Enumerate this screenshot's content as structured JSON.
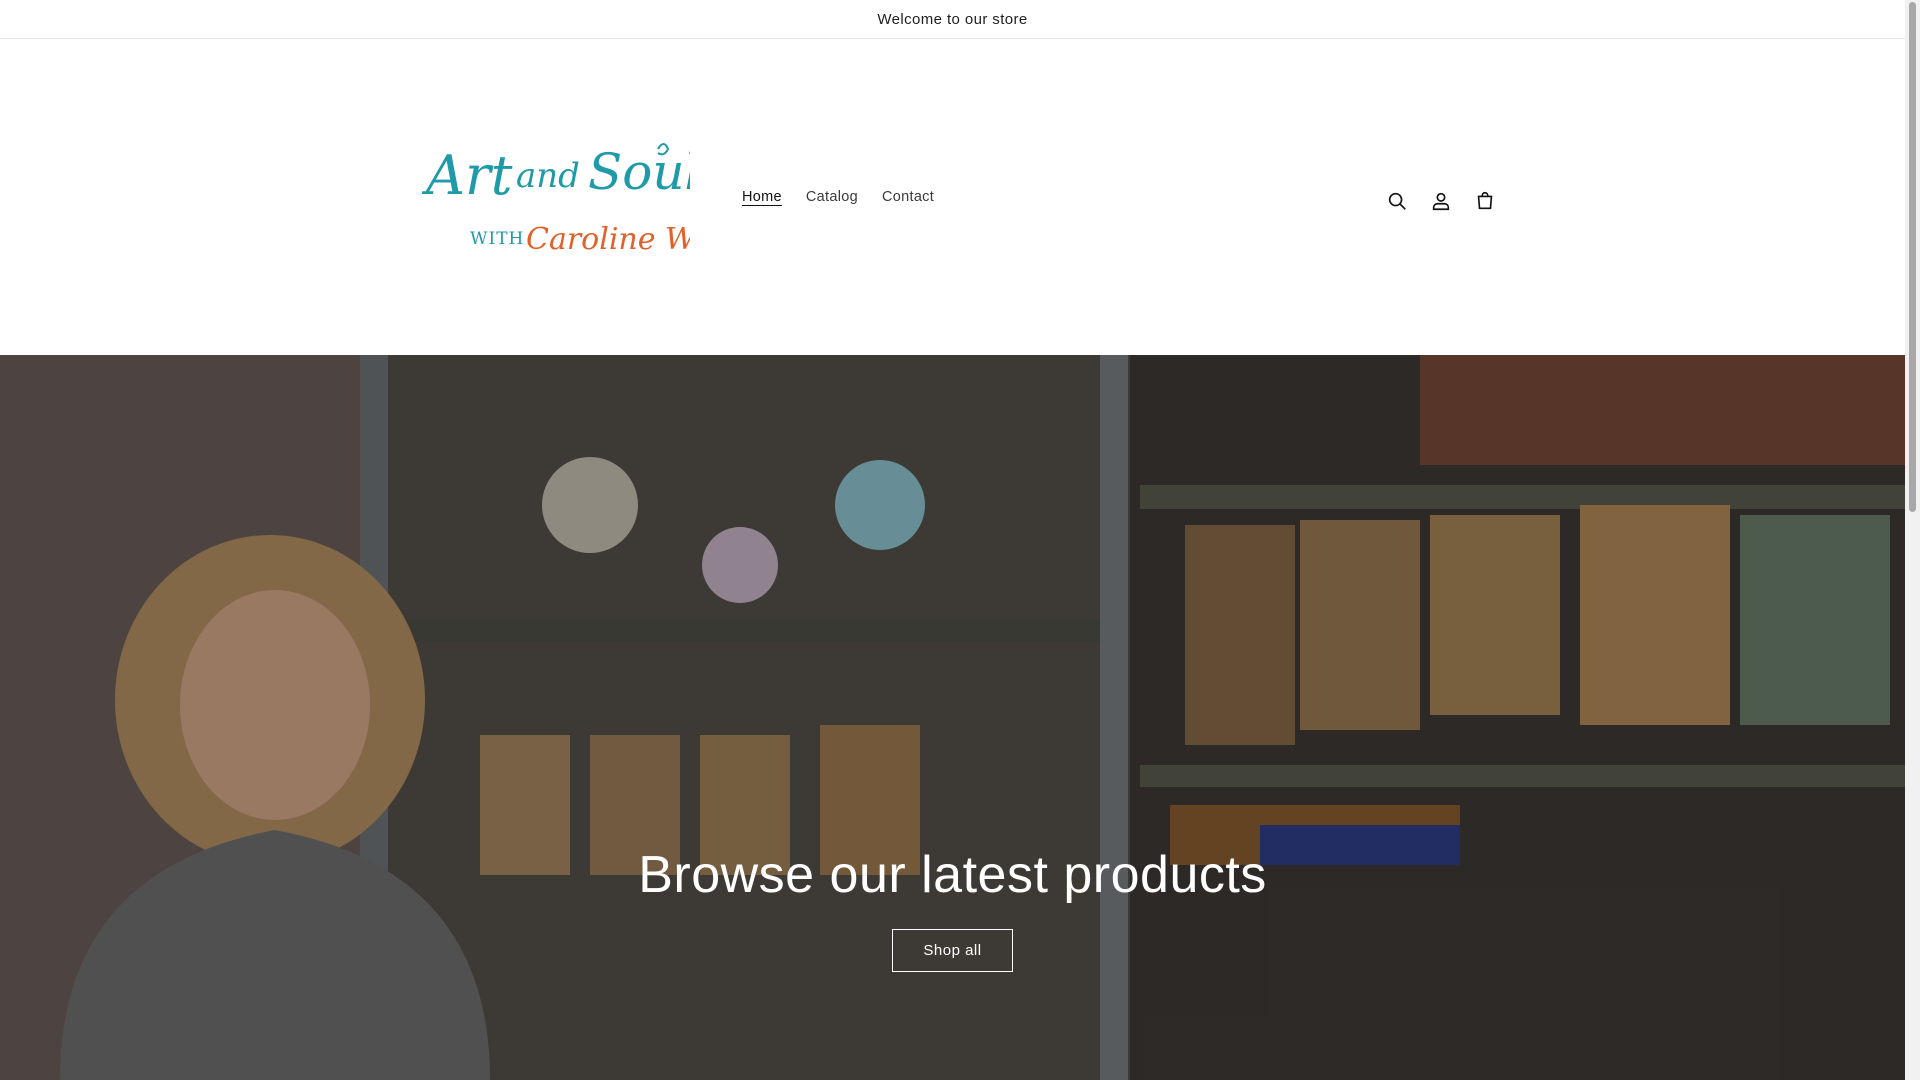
{
  "announcement": {
    "text": "Welcome to our store"
  },
  "header": {
    "logo": {
      "line1": "Art and Soul",
      "line2_prefix": "WITH",
      "line2_name": "Caroline Wood",
      "colors": {
        "teal": "#1f9aa8",
        "orange": "#e0612a"
      }
    },
    "nav": [
      {
        "label": "Home",
        "active": true
      },
      {
        "label": "Catalog",
        "active": false
      },
      {
        "label": "Contact",
        "active": false
      }
    ],
    "icons": [
      "search-icon",
      "account-icon",
      "cart-icon"
    ]
  },
  "hero": {
    "title": "Browse our latest products",
    "button_label": "Shop all"
  }
}
